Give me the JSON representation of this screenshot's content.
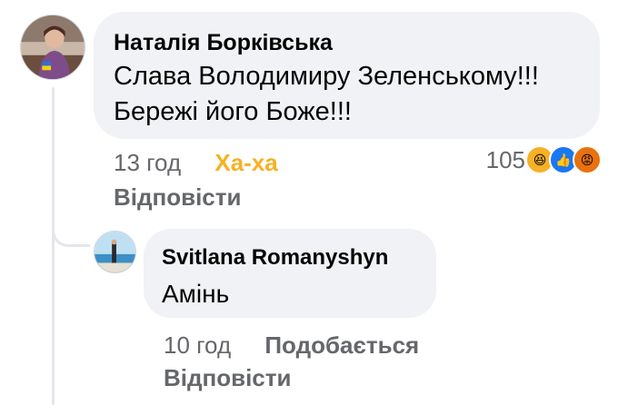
{
  "main_comment": {
    "author": "Наталія Борківська",
    "text_line1": "Слава Володимиру Зеленському!!!",
    "text_line2": "Бережі його Боже!!!",
    "time": "13 год",
    "reaction_label": "Ха-ха",
    "reply_label": "Відповісти",
    "reaction_count": "105",
    "reaction_icons": [
      "haha-icon",
      "like-icon",
      "angry-icon"
    ]
  },
  "reply_comment": {
    "author": "Svitlana Romanyshyn",
    "text": "Амінь",
    "time": "10 год",
    "like_label": "Подобається",
    "reply_label": "Відповісти"
  },
  "colors": {
    "bubble": "#f0f2f5",
    "meta_text": "#65676b",
    "haha_accent": "#f7b125",
    "like_blue": "#1877f2",
    "angry_orange": "#e9710f"
  }
}
